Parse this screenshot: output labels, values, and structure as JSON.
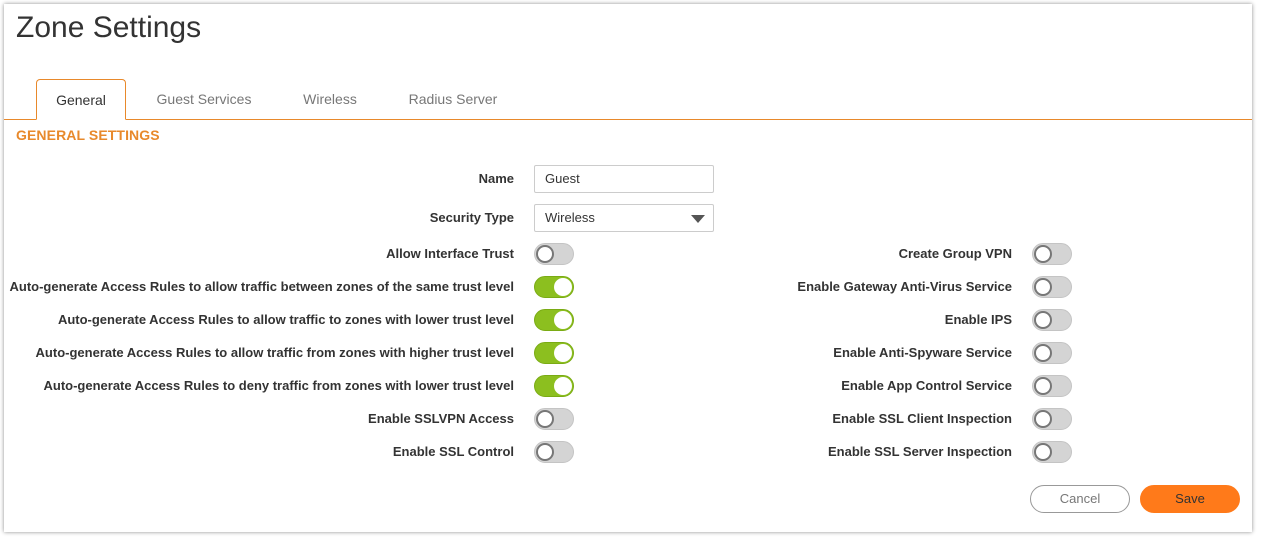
{
  "title": "Zone Settings",
  "tabs": [
    {
      "label": "General",
      "active": true
    },
    {
      "label": "Guest Services",
      "active": false
    },
    {
      "label": "Wireless",
      "active": false
    },
    {
      "label": "Radius Server",
      "active": false
    }
  ],
  "section_title": "GENERAL SETTINGS",
  "name_field": {
    "label": "Name",
    "value": "Guest"
  },
  "security_type": {
    "label": "Security Type",
    "value": "Wireless"
  },
  "left_toggles": [
    {
      "label": "Allow Interface Trust",
      "on": false
    },
    {
      "label": "Auto-generate Access Rules to allow traffic between zones of the same trust level",
      "on": true
    },
    {
      "label": "Auto-generate Access Rules to allow traffic to zones with lower trust level",
      "on": true
    },
    {
      "label": "Auto-generate Access Rules to allow traffic from zones with higher trust level",
      "on": true
    },
    {
      "label": "Auto-generate Access Rules to deny traffic from zones with lower trust level",
      "on": true
    },
    {
      "label": "Enable SSLVPN Access",
      "on": false
    },
    {
      "label": "Enable SSL Control",
      "on": false
    }
  ],
  "right_toggles": [
    {
      "label": "Create Group VPN",
      "on": false
    },
    {
      "label": "Enable Gateway Anti-Virus Service",
      "on": false
    },
    {
      "label": "Enable IPS",
      "on": false
    },
    {
      "label": "Enable Anti-Spyware Service",
      "on": false
    },
    {
      "label": "Enable App Control Service",
      "on": false
    },
    {
      "label": "Enable SSL Client Inspection",
      "on": false
    },
    {
      "label": "Enable SSL Server Inspection",
      "on": false
    }
  ],
  "buttons": {
    "cancel": "Cancel",
    "save": "Save"
  },
  "colors": {
    "accent": "#e8892b",
    "toggle_on": "#8cbf1f",
    "toggle_off": "#d4d4d4",
    "save_button": "#ff7a1a"
  }
}
